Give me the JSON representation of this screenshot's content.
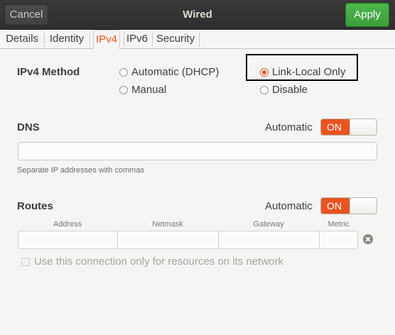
{
  "header": {
    "cancel_label": "Cancel",
    "title": "Wired",
    "apply_label": "Apply",
    "apply_color": "#3c9d3c"
  },
  "tabs": [
    {
      "label": "Details"
    },
    {
      "label": "Identity"
    },
    {
      "label": "IPv4",
      "active": true
    },
    {
      "label": "IPv6"
    },
    {
      "label": "Security"
    }
  ],
  "ipv4_method": {
    "label": "IPv4 Method",
    "options": [
      {
        "label": "Automatic (DHCP)",
        "selected": false
      },
      {
        "label": "Link-Local Only",
        "selected": true
      },
      {
        "label": "Manual",
        "selected": false
      },
      {
        "label": "Disable",
        "selected": false
      }
    ]
  },
  "dns": {
    "label": "DNS",
    "automatic_label": "Automatic",
    "switch_label": "ON",
    "switch_on": true,
    "entry_value": "",
    "hint": "Separate IP addresses with commas"
  },
  "routes": {
    "label": "Routes",
    "automatic_label": "Automatic",
    "switch_label": "ON",
    "switch_on": true,
    "columns": [
      "Address",
      "Netmask",
      "Gateway",
      "Metric"
    ],
    "row": {
      "address": "",
      "netmask": "",
      "gateway": "",
      "metric": ""
    },
    "clear_icon": "clear-circle-icon"
  },
  "restrict_checkbox": {
    "label": "Use this connection only for resources on its network",
    "checked": false,
    "enabled": false
  },
  "colors": {
    "accent": "#e95420",
    "headerbar": "#383838",
    "background": "#f6f5f4"
  }
}
